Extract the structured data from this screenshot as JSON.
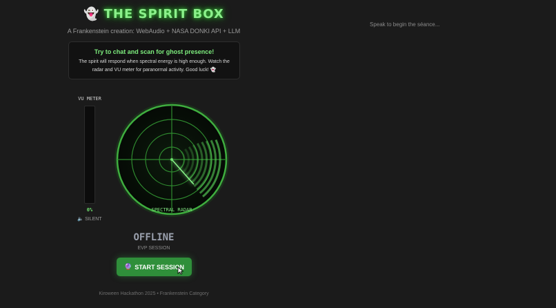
{
  "header": {
    "title": "THE SPIRIT BOX",
    "title_glyph": "👻",
    "subtitle": "A Frankenstein creation: WebAudio + NASA DONKI API + LLM"
  },
  "info": {
    "title": "Try to chat and scan for ghost presence!",
    "body": "The spirit will respond when spectral energy is high enough. Watch the radar and VU meter for paranormal activity. Good luck! 👻"
  },
  "vu_meter": {
    "label": "VU METER",
    "percent_text": "0%",
    "level": 0,
    "status_glyph": "🔈",
    "status_label": "SILENT"
  },
  "radar": {
    "label": "SPECTRAL RADAR"
  },
  "session": {
    "status": "OFFLINE",
    "sub_label": "EVP SESSION",
    "button_glyph": "🔮",
    "button_label": "START SESSION"
  },
  "footer": {
    "text": "Kiroween Hackathon 2025 • Frankenstein Category"
  },
  "chat": {
    "placeholder": "Speak to begin the séance..."
  },
  "colors": {
    "background": "#1b1b1b",
    "accent_green": "#52d152",
    "button_green": "#2f8f3a"
  }
}
